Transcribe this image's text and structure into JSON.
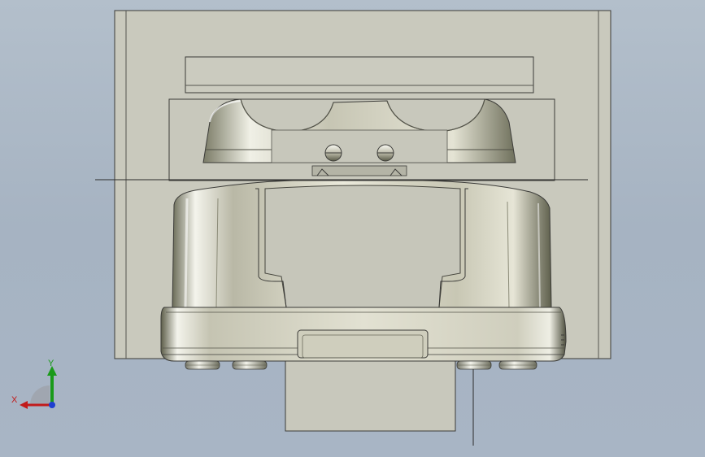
{
  "viewport": {
    "background_top": "#b3bfcb",
    "background_bottom": "#a8b5c5",
    "view": "front"
  },
  "triad": {
    "y_label": "Y",
    "x_label": "X",
    "y_color": "#1a9a1a",
    "x_color": "#c21b1b",
    "z_color": "#1f3fd0"
  }
}
